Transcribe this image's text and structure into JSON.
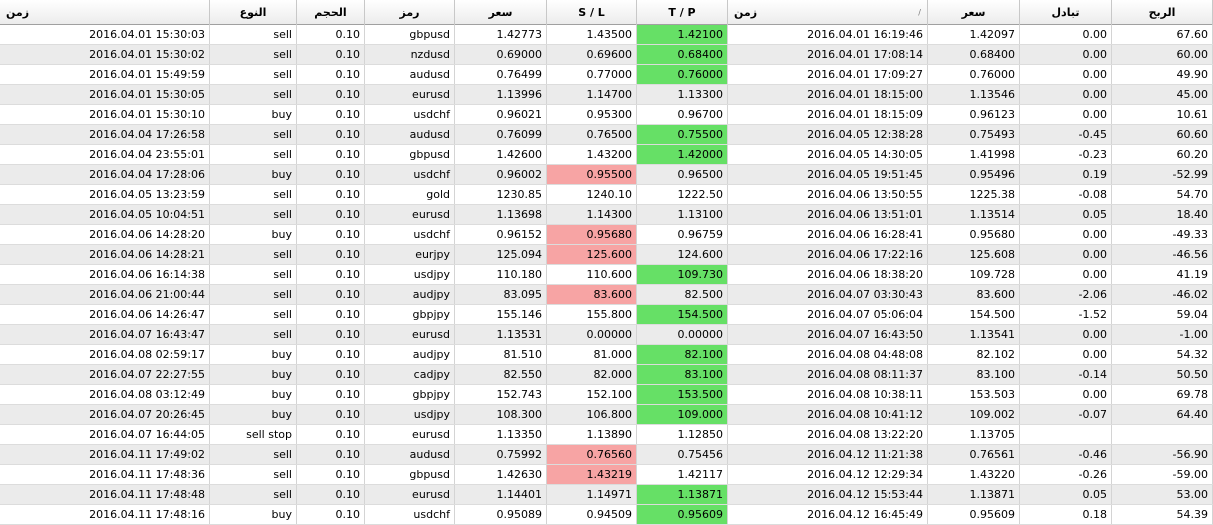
{
  "headers": {
    "open_time": "زمن",
    "type": "النوع",
    "volume": "الحجم",
    "symbol": "رمز",
    "open_price": "سعر",
    "sl": "S / L",
    "tp": "T / P",
    "close_time": "زمن",
    "close_time_sort": "/",
    "close_price": "سعر",
    "swap": "تبادل",
    "profit": "الربح"
  },
  "rows": [
    {
      "open_time": "2016.04.01 15:30:03",
      "type": "sell",
      "volume": "0.10",
      "symbol": "gbpusd",
      "open_price": "1.42773",
      "sl": "1.43500",
      "tp": "1.42100",
      "close_time": "2016.04.01 16:19:46",
      "close_price": "1.42097",
      "swap": "0.00",
      "profit": "67.60",
      "sl_hit": false,
      "tp_hit": true
    },
    {
      "open_time": "2016.04.01 15:30:02",
      "type": "sell",
      "volume": "0.10",
      "symbol": "nzdusd",
      "open_price": "0.69000",
      "sl": "0.69600",
      "tp": "0.68400",
      "close_time": "2016.04.01 17:08:14",
      "close_price": "0.68400",
      "swap": "0.00",
      "profit": "60.00",
      "sl_hit": false,
      "tp_hit": true
    },
    {
      "open_time": "2016.04.01 15:49:59",
      "type": "sell",
      "volume": "0.10",
      "symbol": "audusd",
      "open_price": "0.76499",
      "sl": "0.77000",
      "tp": "0.76000",
      "close_time": "2016.04.01 17:09:27",
      "close_price": "0.76000",
      "swap": "0.00",
      "profit": "49.90",
      "sl_hit": false,
      "tp_hit": true
    },
    {
      "open_time": "2016.04.01 15:30:05",
      "type": "sell",
      "volume": "0.10",
      "symbol": "eurusd",
      "open_price": "1.13996",
      "sl": "1.14700",
      "tp": "1.13300",
      "close_time": "2016.04.01 18:15:00",
      "close_price": "1.13546",
      "swap": "0.00",
      "profit": "45.00",
      "sl_hit": false,
      "tp_hit": false
    },
    {
      "open_time": "2016.04.01 15:30:10",
      "type": "buy",
      "volume": "0.10",
      "symbol": "usdchf",
      "open_price": "0.96021",
      "sl": "0.95300",
      "tp": "0.96700",
      "close_time": "2016.04.01 18:15:09",
      "close_price": "0.96123",
      "swap": "0.00",
      "profit": "10.61",
      "sl_hit": false,
      "tp_hit": false
    },
    {
      "open_time": "2016.04.04 17:26:58",
      "type": "sell",
      "volume": "0.10",
      "symbol": "audusd",
      "open_price": "0.76099",
      "sl": "0.76500",
      "tp": "0.75500",
      "close_time": "2016.04.05 12:38:28",
      "close_price": "0.75493",
      "swap": "-0.45",
      "profit": "60.60",
      "sl_hit": false,
      "tp_hit": true
    },
    {
      "open_time": "2016.04.04 23:55:01",
      "type": "sell",
      "volume": "0.10",
      "symbol": "gbpusd",
      "open_price": "1.42600",
      "sl": "1.43200",
      "tp": "1.42000",
      "close_time": "2016.04.05 14:30:05",
      "close_price": "1.41998",
      "swap": "-0.23",
      "profit": "60.20",
      "sl_hit": false,
      "tp_hit": true
    },
    {
      "open_time": "2016.04.04 17:28:06",
      "type": "buy",
      "volume": "0.10",
      "symbol": "usdchf",
      "open_price": "0.96002",
      "sl": "0.95500",
      "tp": "0.96500",
      "close_time": "2016.04.05 19:51:45",
      "close_price": "0.95496",
      "swap": "0.19",
      "profit": "-52.99",
      "sl_hit": true,
      "tp_hit": false
    },
    {
      "open_time": "2016.04.05 13:23:59",
      "type": "sell",
      "volume": "0.10",
      "symbol": "gold",
      "open_price": "1230.85",
      "sl": "1240.10",
      "tp": "1222.50",
      "close_time": "2016.04.06 13:50:55",
      "close_price": "1225.38",
      "swap": "-0.08",
      "profit": "54.70",
      "sl_hit": false,
      "tp_hit": false
    },
    {
      "open_time": "2016.04.05 10:04:51",
      "type": "sell",
      "volume": "0.10",
      "symbol": "eurusd",
      "open_price": "1.13698",
      "sl": "1.14300",
      "tp": "1.13100",
      "close_time": "2016.04.06 13:51:01",
      "close_price": "1.13514",
      "swap": "0.05",
      "profit": "18.40",
      "sl_hit": false,
      "tp_hit": false
    },
    {
      "open_time": "2016.04.06 14:28:20",
      "type": "buy",
      "volume": "0.10",
      "symbol": "usdchf",
      "open_price": "0.96152",
      "sl": "0.95680",
      "tp": "0.96759",
      "close_time": "2016.04.06 16:28:41",
      "close_price": "0.95680",
      "swap": "0.00",
      "profit": "-49.33",
      "sl_hit": true,
      "tp_hit": false
    },
    {
      "open_time": "2016.04.06 14:28:21",
      "type": "sell",
      "volume": "0.10",
      "symbol": "eurjpy",
      "open_price": "125.094",
      "sl": "125.600",
      "tp": "124.600",
      "close_time": "2016.04.06 17:22:16",
      "close_price": "125.608",
      "swap": "0.00",
      "profit": "-46.56",
      "sl_hit": true,
      "tp_hit": false
    },
    {
      "open_time": "2016.04.06 16:14:38",
      "type": "sell",
      "volume": "0.10",
      "symbol": "usdjpy",
      "open_price": "110.180",
      "sl": "110.600",
      "tp": "109.730",
      "close_time": "2016.04.06 18:38:20",
      "close_price": "109.728",
      "swap": "0.00",
      "profit": "41.19",
      "sl_hit": false,
      "tp_hit": true
    },
    {
      "open_time": "2016.04.06 21:00:44",
      "type": "sell",
      "volume": "0.10",
      "symbol": "audjpy",
      "open_price": "83.095",
      "sl": "83.600",
      "tp": "82.500",
      "close_time": "2016.04.07 03:30:43",
      "close_price": "83.600",
      "swap": "-2.06",
      "profit": "-46.02",
      "sl_hit": true,
      "tp_hit": false
    },
    {
      "open_time": "2016.04.06 14:26:47",
      "type": "sell",
      "volume": "0.10",
      "symbol": "gbpjpy",
      "open_price": "155.146",
      "sl": "155.800",
      "tp": "154.500",
      "close_time": "2016.04.07 05:06:04",
      "close_price": "154.500",
      "swap": "-1.52",
      "profit": "59.04",
      "sl_hit": false,
      "tp_hit": true
    },
    {
      "open_time": "2016.04.07 16:43:47",
      "type": "sell",
      "volume": "0.10",
      "symbol": "eurusd",
      "open_price": "1.13531",
      "sl": "0.00000",
      "tp": "0.00000",
      "close_time": "2016.04.07 16:43:50",
      "close_price": "1.13541",
      "swap": "0.00",
      "profit": "-1.00",
      "sl_hit": false,
      "tp_hit": false
    },
    {
      "open_time": "2016.04.08 02:59:17",
      "type": "buy",
      "volume": "0.10",
      "symbol": "audjpy",
      "open_price": "81.510",
      "sl": "81.000",
      "tp": "82.100",
      "close_time": "2016.04.08 04:48:08",
      "close_price": "82.102",
      "swap": "0.00",
      "profit": "54.32",
      "sl_hit": false,
      "tp_hit": true
    },
    {
      "open_time": "2016.04.07 22:27:55",
      "type": "buy",
      "volume": "0.10",
      "symbol": "cadjpy",
      "open_price": "82.550",
      "sl": "82.000",
      "tp": "83.100",
      "close_time": "2016.04.08 08:11:37",
      "close_price": "83.100",
      "swap": "-0.14",
      "profit": "50.50",
      "sl_hit": false,
      "tp_hit": true
    },
    {
      "open_time": "2016.04.08 03:12:49",
      "type": "buy",
      "volume": "0.10",
      "symbol": "gbpjpy",
      "open_price": "152.743",
      "sl": "152.100",
      "tp": "153.500",
      "close_time": "2016.04.08 10:38:11",
      "close_price": "153.503",
      "swap": "0.00",
      "profit": "69.78",
      "sl_hit": false,
      "tp_hit": true
    },
    {
      "open_time": "2016.04.07 20:26:45",
      "type": "buy",
      "volume": "0.10",
      "symbol": "usdjpy",
      "open_price": "108.300",
      "sl": "106.800",
      "tp": "109.000",
      "close_time": "2016.04.08 10:41:12",
      "close_price": "109.002",
      "swap": "-0.07",
      "profit": "64.40",
      "sl_hit": false,
      "tp_hit": true
    },
    {
      "open_time": "2016.04.07 16:44:05",
      "type": "sell stop",
      "volume": "0.10",
      "symbol": "eurusd",
      "open_price": "1.13350",
      "sl": "1.13890",
      "tp": "1.12850",
      "close_time": "2016.04.08 13:22:20",
      "close_price": "1.13705",
      "swap": "",
      "profit": "",
      "sl_hit": false,
      "tp_hit": false
    },
    {
      "open_time": "2016.04.11 17:49:02",
      "type": "sell",
      "volume": "0.10",
      "symbol": "audusd",
      "open_price": "0.75992",
      "sl": "0.76560",
      "tp": "0.75456",
      "close_time": "2016.04.12 11:21:38",
      "close_price": "0.76561",
      "swap": "-0.46",
      "profit": "-56.90",
      "sl_hit": true,
      "tp_hit": false
    },
    {
      "open_time": "2016.04.11 17:48:36",
      "type": "sell",
      "volume": "0.10",
      "symbol": "gbpusd",
      "open_price": "1.42630",
      "sl": "1.43219",
      "tp": "1.42117",
      "close_time": "2016.04.12 12:29:34",
      "close_price": "1.43220",
      "swap": "-0.26",
      "profit": "-59.00",
      "sl_hit": true,
      "tp_hit": false
    },
    {
      "open_time": "2016.04.11 17:48:48",
      "type": "sell",
      "volume": "0.10",
      "symbol": "eurusd",
      "open_price": "1.14401",
      "sl": "1.14971",
      "tp": "1.13871",
      "close_time": "2016.04.12 15:53:44",
      "close_price": "1.13871",
      "swap": "0.05",
      "profit": "53.00",
      "sl_hit": false,
      "tp_hit": true
    },
    {
      "open_time": "2016.04.11 17:48:16",
      "type": "buy",
      "volume": "0.10",
      "symbol": "usdchf",
      "open_price": "0.95089",
      "sl": "0.94509",
      "tp": "0.95609",
      "close_time": "2016.04.12 16:45:49",
      "close_price": "0.95609",
      "swap": "0.18",
      "profit": "54.39",
      "sl_hit": false,
      "tp_hit": true
    }
  ],
  "colors": {
    "tp_hit": "#66e066",
    "sl_hit": "#f7a4a4",
    "alt_row": "#ebebeb"
  }
}
